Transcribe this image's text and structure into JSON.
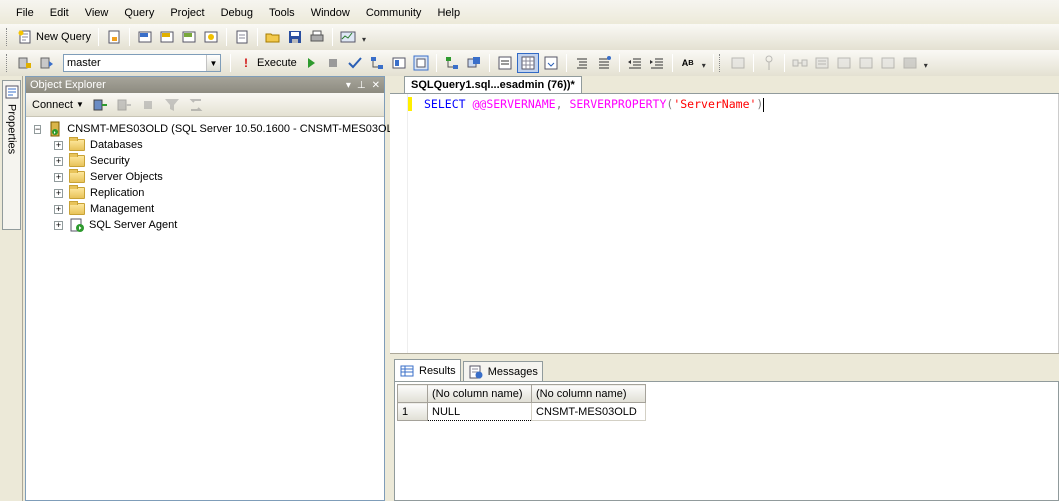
{
  "menu": [
    "File",
    "Edit",
    "View",
    "Query",
    "Project",
    "Debug",
    "Tools",
    "Window",
    "Community",
    "Help"
  ],
  "toolbar": {
    "new_query_label": "New Query",
    "database_selected": "master",
    "execute_label": "Execute"
  },
  "sidebar": {
    "properties_label": "Properties"
  },
  "object_explorer": {
    "title": "Object Explorer",
    "connect_label": "Connect",
    "server_node": "CNSMT-MES03OLD (SQL Server 10.50.1600 - CNSMT-MES03OLD\\",
    "nodes": [
      "Databases",
      "Security",
      "Server Objects",
      "Replication",
      "Management",
      "SQL Server Agent"
    ]
  },
  "query_editor": {
    "tab_title": "SQLQuery1.sql...esadmin (76))*",
    "code": {
      "select": "SELECT",
      "at_var": "@@SERVERNAME",
      "comma": ",",
      "fn": "SERVERPROPERTY",
      "open": "(",
      "str": "'ServerName'",
      "close": ")"
    }
  },
  "results": {
    "tabs": [
      "Results",
      "Messages"
    ],
    "columns": [
      "(No column name)",
      "(No column name)"
    ],
    "rows": [
      {
        "row_number": "1",
        "cells": [
          "NULL",
          "CNSMT-MES03OLD"
        ]
      }
    ]
  },
  "colors": {
    "keyword": "#0000ff",
    "function": "#ff00ff",
    "string": "#ff0000"
  }
}
